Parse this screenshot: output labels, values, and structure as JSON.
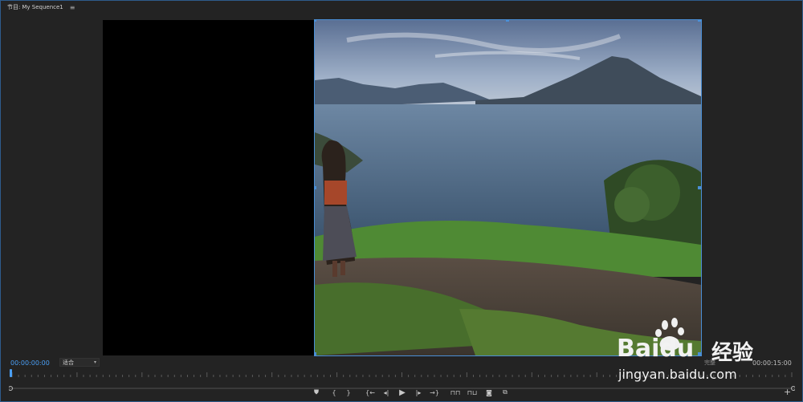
{
  "panel": {
    "title_prefix": "节目:",
    "sequence_name": "My Sequence1",
    "menu_icon": "hamburger-icon"
  },
  "monitor": {
    "timecode_current": "00:00:00:00",
    "fit_value": "适合",
    "resolution_label": "完整",
    "timecode_duration": "00:00:15:00",
    "playhead_position_fraction": 0
  },
  "transport": {
    "buttons": [
      {
        "name": "add-marker-button",
        "icon": "marker-icon"
      },
      {
        "name": "mark-in-button",
        "icon": "mark-in-icon"
      },
      {
        "name": "mark-out-button",
        "icon": "mark-out-icon"
      },
      {
        "name": "go-to-in-button",
        "icon": "go-to-in-icon"
      },
      {
        "name": "step-back-button",
        "icon": "step-back-icon"
      },
      {
        "name": "play-button",
        "icon": "play-icon"
      },
      {
        "name": "step-forward-button",
        "icon": "step-forward-icon"
      },
      {
        "name": "go-to-out-button",
        "icon": "go-to-out-icon"
      },
      {
        "name": "lift-button",
        "icon": "lift-icon"
      },
      {
        "name": "extract-button",
        "icon": "extract-icon"
      },
      {
        "name": "export-frame-button",
        "icon": "camera-icon"
      },
      {
        "name": "comparison-view-button",
        "icon": "comparison-icon"
      }
    ],
    "add_button_icon": "plus-icon"
  },
  "watermark": {
    "brand": "Baidu",
    "brand_cn": "经验",
    "url": "jingyan.baidu.com"
  },
  "colors": {
    "accent": "#4a9ff5",
    "panel_border": "#2e5b8c",
    "background": "#232323"
  }
}
